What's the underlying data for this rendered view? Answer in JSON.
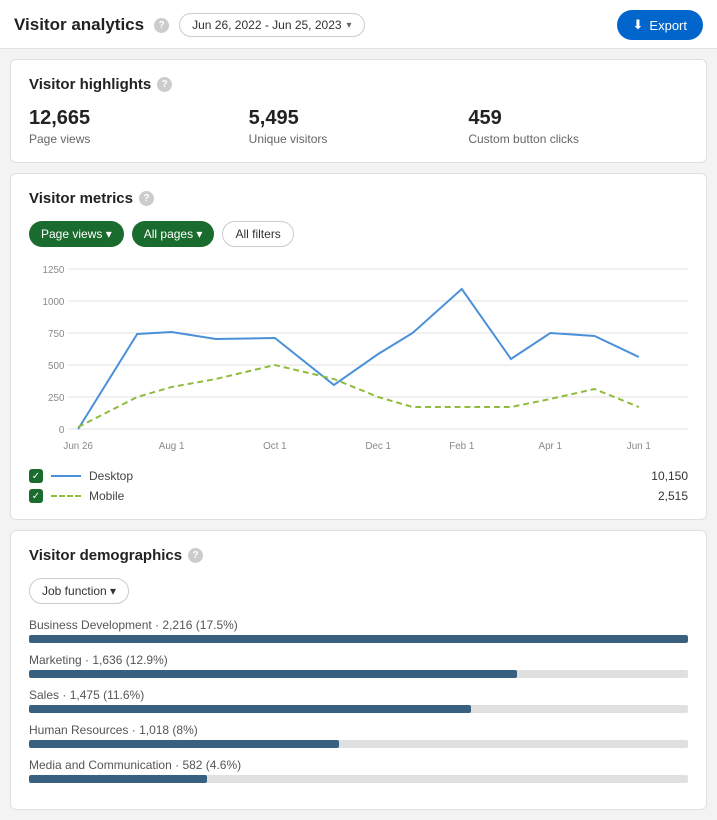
{
  "header": {
    "title": "Visitor analytics",
    "info_icon": "ℹ",
    "date_range": "Jun 26, 2022 - Jun 25, 2023",
    "export_label": "Export"
  },
  "highlights": {
    "title": "Visitor highlights",
    "items": [
      {
        "value": "12,665",
        "label": "Page views"
      },
      {
        "value": "5,495",
        "label": "Unique visitors"
      },
      {
        "value": "459",
        "label": "Custom button clicks"
      }
    ]
  },
  "metrics": {
    "title": "Visitor metrics",
    "filters": {
      "page_views": "Page views ▾",
      "all_pages": "All pages ▾",
      "all_filters": "All filters"
    },
    "y_labels": [
      "1250",
      "1000",
      "750",
      "500",
      "250",
      "0"
    ],
    "x_labels": [
      "Jun 26",
      "Aug 1",
      "Oct 1",
      "Dec 1",
      "Feb 1",
      "Apr 1",
      "Jun 1"
    ],
    "legend": [
      {
        "type": "solid",
        "label": "Desktop",
        "value": "10,150"
      },
      {
        "type": "dashed",
        "label": "Mobile",
        "value": "2,515"
      }
    ]
  },
  "demographics": {
    "title": "Visitor demographics",
    "filter_label": "Job function ▾",
    "bars": [
      {
        "label": "Business Development",
        "stat": "2,216 (17.5%)",
        "pct": 100
      },
      {
        "label": "Marketing",
        "stat": "1,636 (12.9%)",
        "pct": 74
      },
      {
        "label": "Sales",
        "stat": "1,475 (11.6%)",
        "pct": 67
      },
      {
        "label": "Human Resources",
        "stat": "1,018 (8%)",
        "pct": 47
      },
      {
        "label": "Media and Communication",
        "stat": "582 (4.6%)",
        "pct": 27
      }
    ]
  }
}
